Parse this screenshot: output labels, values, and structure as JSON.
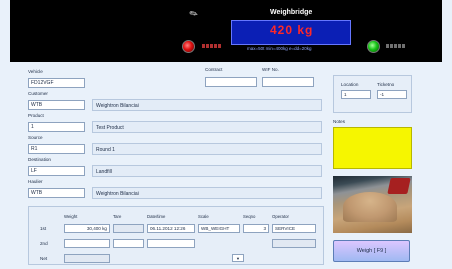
{
  "weighbridge": {
    "title": "Weighbridge",
    "weight": "420 kg",
    "status": "max=50t  min=400kg  e=dd=20kg"
  },
  "contract": {
    "label": "Contract",
    "value": ""
  },
  "wif_no": {
    "label": "WIF No.",
    "value": ""
  },
  "vehicle": {
    "label": "Vehicle",
    "value": "FD12VGF"
  },
  "customer": {
    "label": "Customer",
    "code": "WTB",
    "name": "Weightron Bilanciai"
  },
  "product": {
    "label": "Product",
    "code": "1",
    "name": "Test Product"
  },
  "source": {
    "label": "Source",
    "code": "R1",
    "name": "Round 1"
  },
  "destination": {
    "label": "Destination",
    "code": "LF",
    "name": "Landfill"
  },
  "haulier": {
    "label": "Haulier",
    "code": "WTB",
    "name": "Weightron Bilanciai"
  },
  "location": {
    "label": "Location",
    "value": "1"
  },
  "ticket_no": {
    "label": "Ticketno",
    "value": "-1"
  },
  "notes": {
    "label": "Notes",
    "value": ""
  },
  "weighings": {
    "headers": [
      "Weight",
      "Tare",
      "Date/time",
      "Scale",
      "Seqno",
      "Operator"
    ],
    "rows": [
      {
        "label": "1st",
        "weight": "30,400 kg",
        "tare": "",
        "datetime": "06.11.2012 12:26",
        "scale": "WB_WEIGHT",
        "seqno": "3",
        "operator": "SERVICE"
      },
      {
        "label": "2nd",
        "weight": "",
        "tare": "",
        "datetime": "",
        "scale": "",
        "seqno": "",
        "operator": ""
      },
      {
        "label": "Net",
        "weight": "",
        "tare": "",
        "datetime": "",
        "scale": "",
        "seqno": "",
        "operator": ""
      }
    ],
    "select_symbol": "▼"
  },
  "weigh_button": {
    "label": "Weigh  [ F9 ]"
  },
  "icons": {
    "scale": "pen-icon",
    "left_light": "red-light-icon",
    "right_light": "green-light-icon"
  },
  "colors": {
    "display_bg": "#0b1fb5",
    "weight_text": "#ff2828",
    "notes_bg": "#f6f600"
  }
}
